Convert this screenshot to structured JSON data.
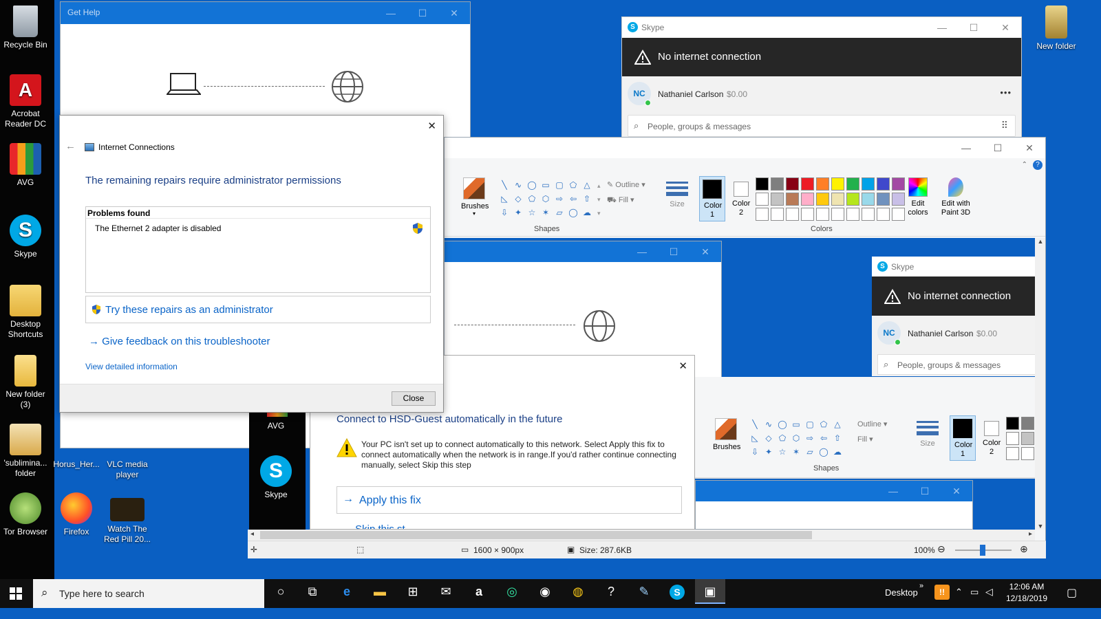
{
  "desktop": {
    "icons": [
      {
        "label": "Recycle Bin",
        "icon": "recycle-bin-icon"
      },
      {
        "label": "Acrobat Reader DC",
        "icon": "acrobat-icon"
      },
      {
        "label": "AVG",
        "icon": "avg-icon"
      },
      {
        "label": "Skype",
        "icon": "skype-icon"
      },
      {
        "label": "Desktop Shortcuts",
        "icon": "folder-icon"
      },
      {
        "label": "New folder (3)",
        "icon": "folder-icon"
      },
      {
        "label": "'sublimina... folder",
        "icon": "folder-icon"
      },
      {
        "label": "Tor Browser",
        "icon": "tor-icon"
      },
      {
        "label": "Horus_Her...",
        "icon": "image-icon"
      },
      {
        "label": "VLC media player",
        "icon": "vlc-icon"
      },
      {
        "label": "Firefox",
        "icon": "firefox-icon"
      },
      {
        "label": "Watch The Red Pill 20...",
        "icon": "video-icon"
      },
      {
        "label": "New folder",
        "icon": "folder-icon"
      }
    ]
  },
  "get_help": {
    "title": "Get Help",
    "minimize": "—",
    "maximize": "☐",
    "close": "✕"
  },
  "internet_connections": {
    "back": "←",
    "title": "Internet Connections",
    "heading": "The remaining repairs require administrator permissions",
    "problems_header": "Problems found",
    "problem": "The Ethernet 2 adapter is disabled",
    "admin_repair": "Try these repairs as an administrator",
    "feedback": "Give feedback on this troubleshooter",
    "details": "View detailed information",
    "close_button": "Close",
    "close_x": "✕"
  },
  "skype_top": {
    "title": "Skype",
    "banner": "No internet connection",
    "avatar": "NC",
    "user": "Nathaniel Carlson",
    "balance": "$0.00",
    "more": "•••",
    "search_placeholder": "People, groups & messages"
  },
  "paint": {
    "brushes": "Brushes",
    "shapes_label": "Shapes",
    "outline": "Outline",
    "fill": "Fill",
    "size": "Size",
    "color1": "Color 1",
    "color2": "Color 2",
    "colors_label": "Colors",
    "edit_colors": "Edit colors",
    "edit_paint3d": "Edit with Paint 3D",
    "palette_row1": [
      "#000000",
      "#7f7f7f",
      "#880015",
      "#ed1c24",
      "#ff7f27",
      "#fff200",
      "#22b14c",
      "#00a2e8",
      "#3f48cc",
      "#a349a4"
    ],
    "palette_row2": [
      "#ffffff",
      "#c3c3c3",
      "#b97a57",
      "#ffaec9",
      "#ffc90e",
      "#efe4b0",
      "#b5e61d",
      "#99d9ea",
      "#7092be",
      "#c8bfe7"
    ]
  },
  "skype_inner": {
    "title": "Skype",
    "banner": "No internet connection",
    "avatar": "NC",
    "user": "Nathaniel Carlson",
    "balance": "$0.00",
    "search_placeholder": "People, groups & messages"
  },
  "hsd_dialog": {
    "heading": "Connect to HSD-Guest automatically in the future",
    "message": "Your PC isn't set up to connect automatically to this network. Select Apply this fix to connect automatically when the network is in range.If you'd rather continue connecting manually, select Skip this step",
    "apply": "Apply this fix",
    "skip": "Skip this st...",
    "close_x": "✕"
  },
  "statusbar": {
    "dimensions": "1600 × 900px",
    "size": "Size: 287.6KB",
    "zoom": "100%"
  },
  "taskbar": {
    "search_placeholder": "Type here to search",
    "desktop_label": "Desktop",
    "time": "12:06 AM",
    "date": "12/18/2019"
  }
}
